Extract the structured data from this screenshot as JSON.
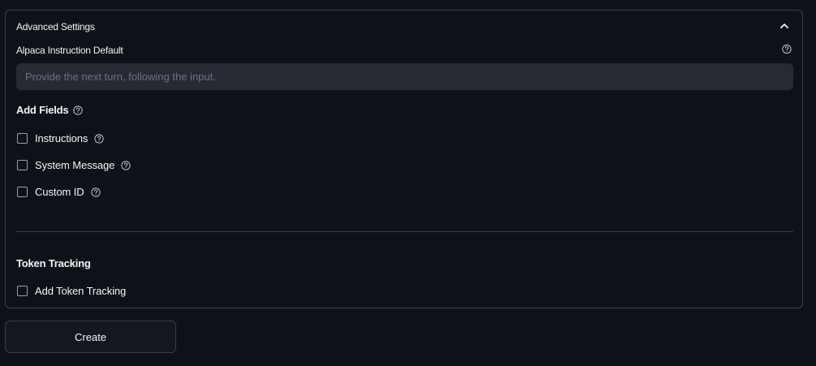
{
  "advanced_settings": {
    "title": "Advanced Settings",
    "expanded": true,
    "collapse_icon": "chevron-up-icon"
  },
  "alpaca_instruction": {
    "label": "Alpaca Instruction Default",
    "value": "",
    "placeholder": "Provide the next turn, following the input.",
    "help_icon": "help-circle-icon"
  },
  "add_fields": {
    "title": "Add Fields",
    "options": [
      {
        "label": "Instructions",
        "checked": false
      },
      {
        "label": "System Message",
        "checked": false
      },
      {
        "label": "Custom ID",
        "checked": false
      }
    ]
  },
  "token_tracking": {
    "title": "Token Tracking",
    "option": {
      "label": "Add Token Tracking",
      "checked": false
    }
  },
  "create_button": {
    "label": "Create"
  },
  "colors": {
    "background": "#0e1117",
    "border": "#3a3f4a",
    "input_bg": "#262a33",
    "text": "#f3f4f6",
    "placeholder": "#6b7280"
  }
}
